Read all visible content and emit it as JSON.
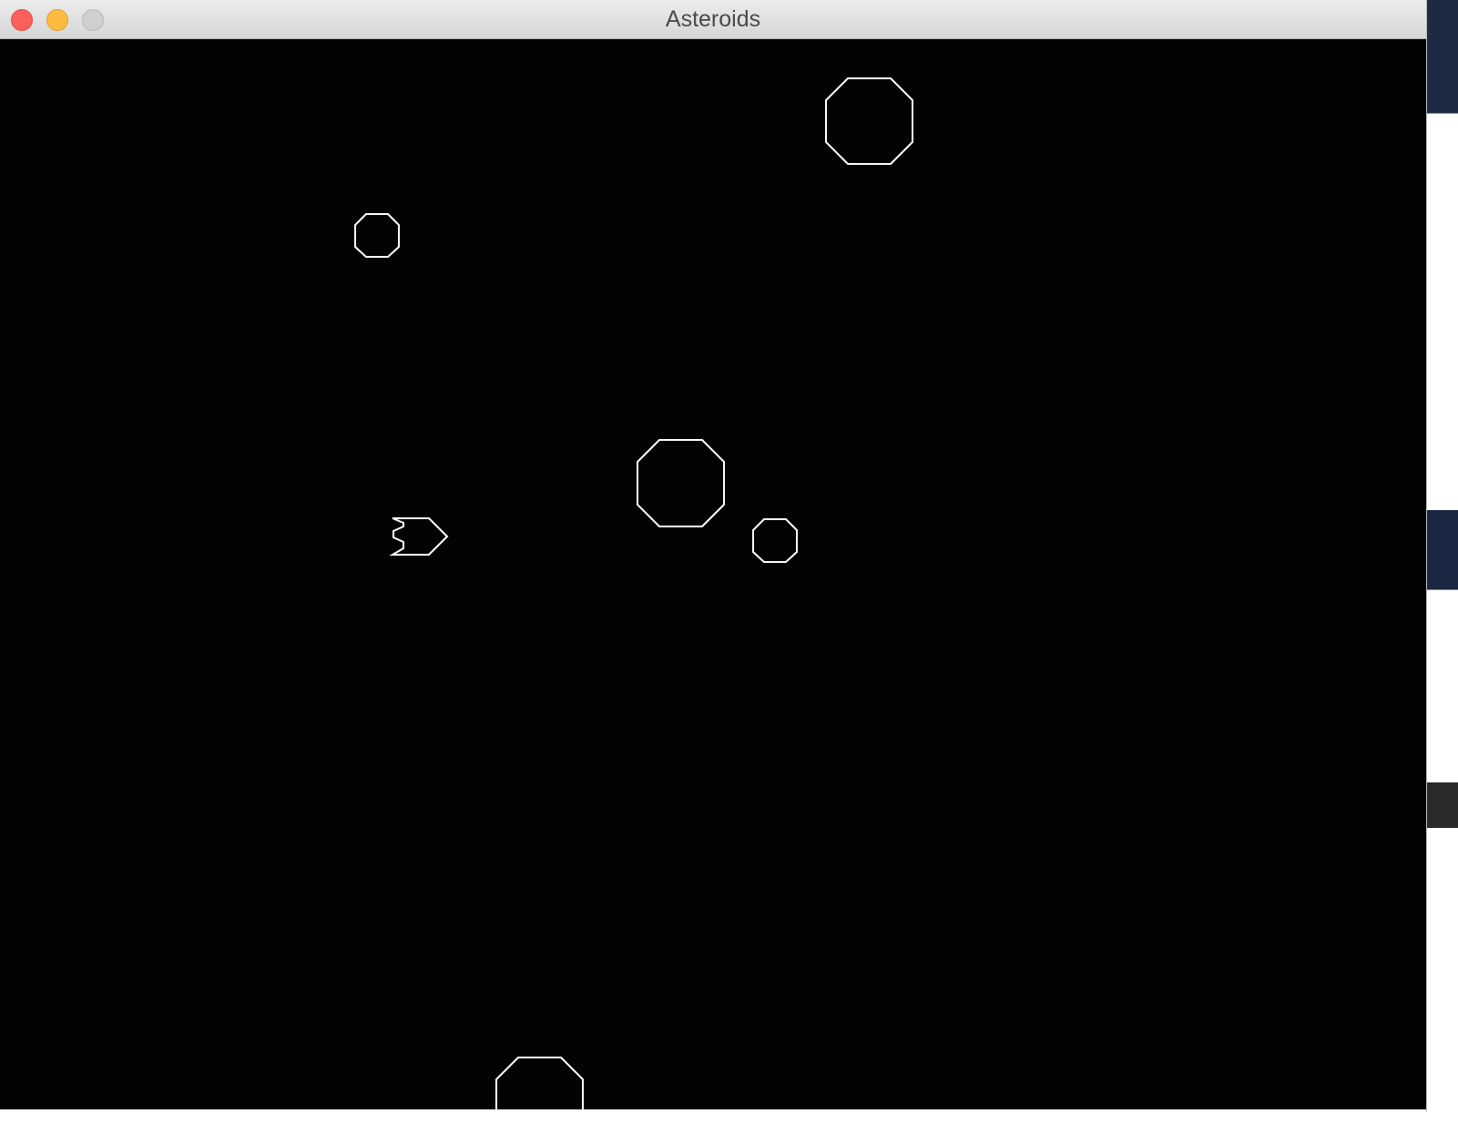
{
  "window": {
    "title": "Asteroids",
    "buttons": {
      "close": "close-icon",
      "minimize": "minimize-icon",
      "zoom": "zoom-icon"
    }
  },
  "game": {
    "background_color": "#030303",
    "stroke_color": "#ffffff",
    "entities": {
      "ship": {
        "type": "ship",
        "heading": "right"
      },
      "asteroids": [
        {
          "size": "large"
        },
        {
          "size": "small"
        },
        {
          "size": "large"
        },
        {
          "size": "small"
        },
        {
          "size": "large",
          "partially_visible": true
        }
      ]
    }
  }
}
